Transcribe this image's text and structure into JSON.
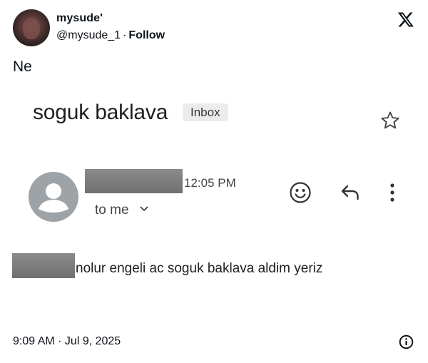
{
  "tweet": {
    "display_name": "mysude'",
    "handle": "@mysude_1",
    "separator": "·",
    "follow_label": "Follow",
    "text": "Ne",
    "timestamp": "9:09 AM · Jul 9, 2025"
  },
  "email": {
    "subject": "soguk baklava",
    "label_badge": "Inbox",
    "time": "12:05 PM",
    "recipient": "to me",
    "body": "nolur engeli ac soguk baklava aldim yeriz"
  },
  "icons": {
    "platform_logo": "x-logo-icon",
    "star": "star-icon",
    "emoji": "emoji-reaction-icon",
    "reply": "reply-icon",
    "more": "more-vertical-icon",
    "chevron": "chevron-down-icon",
    "info": "info-icon"
  },
  "colors": {
    "redaction": "#7d7d7d",
    "sender_avatar": "#9ea3a8",
    "badge_bg": "#ececec"
  }
}
